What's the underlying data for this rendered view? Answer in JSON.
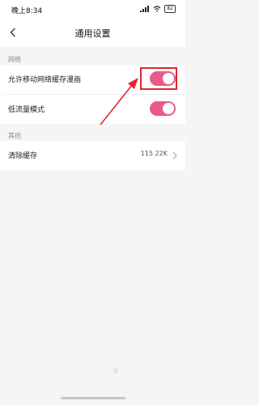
{
  "status_bar": {
    "time": "晚上8:34",
    "battery": "82"
  },
  "header": {
    "title": "通用设置"
  },
  "sections": [
    {
      "label": "网络"
    },
    {
      "label": "其他"
    }
  ],
  "settings": {
    "allow_mobile_cache": {
      "label": "允许移动网络缓存漫画",
      "enabled": true
    },
    "low_data_mode": {
      "label": "低流量模式",
      "enabled": true
    },
    "clear_cache": {
      "label": "清除缓存",
      "value": "115.22K"
    }
  },
  "colors": {
    "accent": "#ea5a86",
    "annotation": "#e0262e"
  },
  "watermark": "B"
}
